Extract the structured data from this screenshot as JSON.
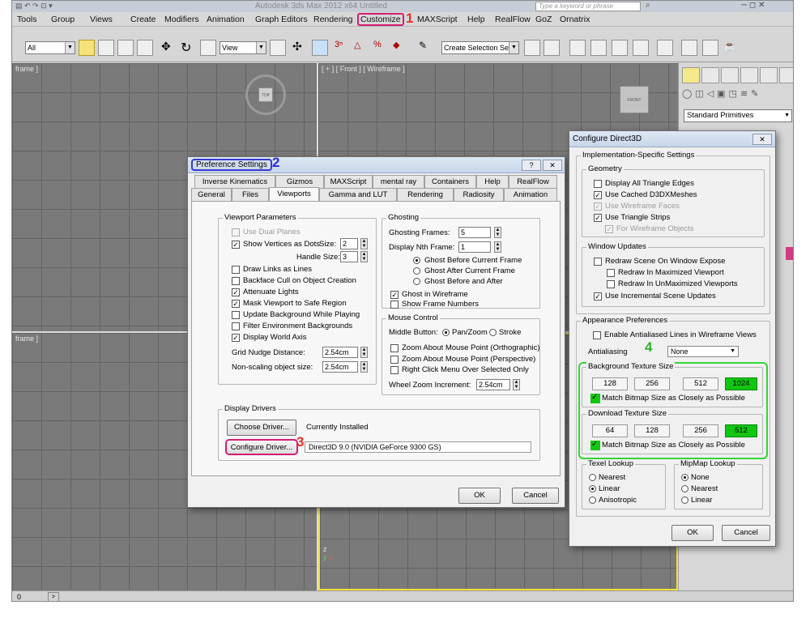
{
  "app": {
    "title": "Autodesk 3ds Max 2012 x64    Untitled",
    "search_placeholder": "Type a keyword or phrase"
  },
  "menubar": {
    "items": [
      "Tools",
      "Group",
      "Views",
      "Create",
      "Modifiers",
      "Animation",
      "Graph Editors",
      "Rendering",
      "Customize",
      "MAXScript",
      "Help",
      "RealFlow",
      "GoZ",
      "Ornatrix"
    ]
  },
  "toolbar": {
    "selection_filter": "All",
    "ref_coord": "View",
    "named_selection": "Create Selection Se"
  },
  "viewports": {
    "top_left_label": "frame ]",
    "front_label": "[ + ] [ Front ] [ Wireframe ]",
    "left_label": "frame ]",
    "viewcube_top": "TOP",
    "viewcube_front": "FRONT"
  },
  "command_panel": {
    "dropdown": "Standard Primitives"
  },
  "statusbar": {
    "frame_start": "0",
    "arrow": ">"
  },
  "annotations": {
    "n1": "1",
    "n2": "2",
    "n3": "3",
    "n4": "4"
  },
  "pref": {
    "title": "Preference Settings",
    "help_btn": "?",
    "close_btn": "✕",
    "tabs_row1": [
      "Inverse Kinematics",
      "Gizmos",
      "MAXScript",
      "mental ray",
      "Containers",
      "Help",
      "RealFlow"
    ],
    "tabs_row2": [
      "General",
      "Files",
      "Viewports",
      "Gamma and LUT",
      "Rendering",
      "Radiosity",
      "Animation"
    ],
    "viewport_params": {
      "title": "Viewport Parameters",
      "use_dual_planes": "Use Dual Planes",
      "show_vertices": "Show Vertices as Dots",
      "size_label": "Size:",
      "size_value": "2",
      "handle_size_label": "Handle Size:",
      "handle_size_value": "3",
      "draw_links": "Draw Links as Lines",
      "backface_cull": "Backface Cull on Object Creation",
      "attenuate_lights": "Attenuate Lights",
      "mask_viewport": "Mask Viewport to Safe Region",
      "update_background": "Update Background While Playing",
      "filter_env": "Filter Environment Backgrounds",
      "display_world_axis": "Display World Axis",
      "grid_nudge_label": "Grid Nudge Distance:",
      "grid_nudge_value": "2.54cm",
      "nonscaling_label": "Non-scaling object size:",
      "nonscaling_value": "2.54cm"
    },
    "ghosting": {
      "title": "Ghosting",
      "frames_label": "Ghosting Frames:",
      "frames_value": "5",
      "nth_label": "Display Nth Frame:",
      "nth_value": "1",
      "before": "Ghost Before Current Frame",
      "after": "Ghost After Current Frame",
      "both": "Ghost Before and After",
      "in_wireframe": "Ghost in Wireframe",
      "show_numbers": "Show Frame Numbers"
    },
    "mouse": {
      "title": "Mouse Control",
      "middle_label": "Middle Button:",
      "pan_zoom": "Pan/Zoom",
      "stroke": "Stroke",
      "zoom_ortho": "Zoom About Mouse Point (Orthographic)",
      "zoom_persp": "Zoom About Mouse Point (Perspective)",
      "right_click": "Right Click Menu Over Selected Only",
      "wheel_label": "Wheel Zoom Increment:",
      "wheel_value": "2.54cm"
    },
    "drivers": {
      "title": "Display Drivers",
      "choose": "Choose Driver...",
      "currently": "Currently Installed",
      "configure": "Configure Driver...",
      "driver_name": "Direct3D 9.0 (NVIDIA GeForce 9300 GS)"
    },
    "ok": "OK",
    "cancel": "Cancel"
  },
  "d3d": {
    "title": "Configure Direct3D",
    "close_btn": "✕",
    "impl": "Implementation-Specific Settings",
    "geometry": "Geometry",
    "display_all_tri": "Display All Triangle Edges",
    "use_cached": "Use Cached D3DXMeshes",
    "use_wire_faces": "Use Wireframe Faces",
    "use_tri_strips": "Use Triangle Strips",
    "for_wire_objects": "For Wireframe Objects",
    "window_updates": "Window Updates",
    "redraw_expose": "Redraw Scene On Window Expose",
    "redraw_max": "Redraw In Maximized Viewport",
    "redraw_unmax": "Redraw In UnMaximized Viewports",
    "incremental": "Use Incremental Scene Updates",
    "appearance": "Appearance Preferences",
    "antialiased": "Enable Antialiased Lines in Wireframe Views",
    "antialiasing_label": "Antialiasing",
    "antialiasing_value": "None",
    "bg_texture": "Background Texture Size",
    "bg_sizes": [
      "128",
      "256",
      "512",
      "1024"
    ],
    "match_bitmap": "Match Bitmap Size as Closely as Possible",
    "dl_texture": "Download Texture Size",
    "dl_sizes": [
      "64",
      "128",
      "256",
      "512"
    ],
    "texel": "Texel Lookup",
    "nearest": "Nearest",
    "linear": "Linear",
    "anisotropic": "Anisotropic",
    "mipmap": "MipMap Lookup",
    "none": "None",
    "mip_nearest": "Nearest",
    "mip_linear": "Linear",
    "ok": "OK",
    "cancel": "Cancel"
  },
  "colors": {
    "highlight_green": "#12c612",
    "annotation_red": "#e5312a",
    "annotation_blue": "#2a2ad8",
    "annotation_pink": "#d21e72"
  }
}
